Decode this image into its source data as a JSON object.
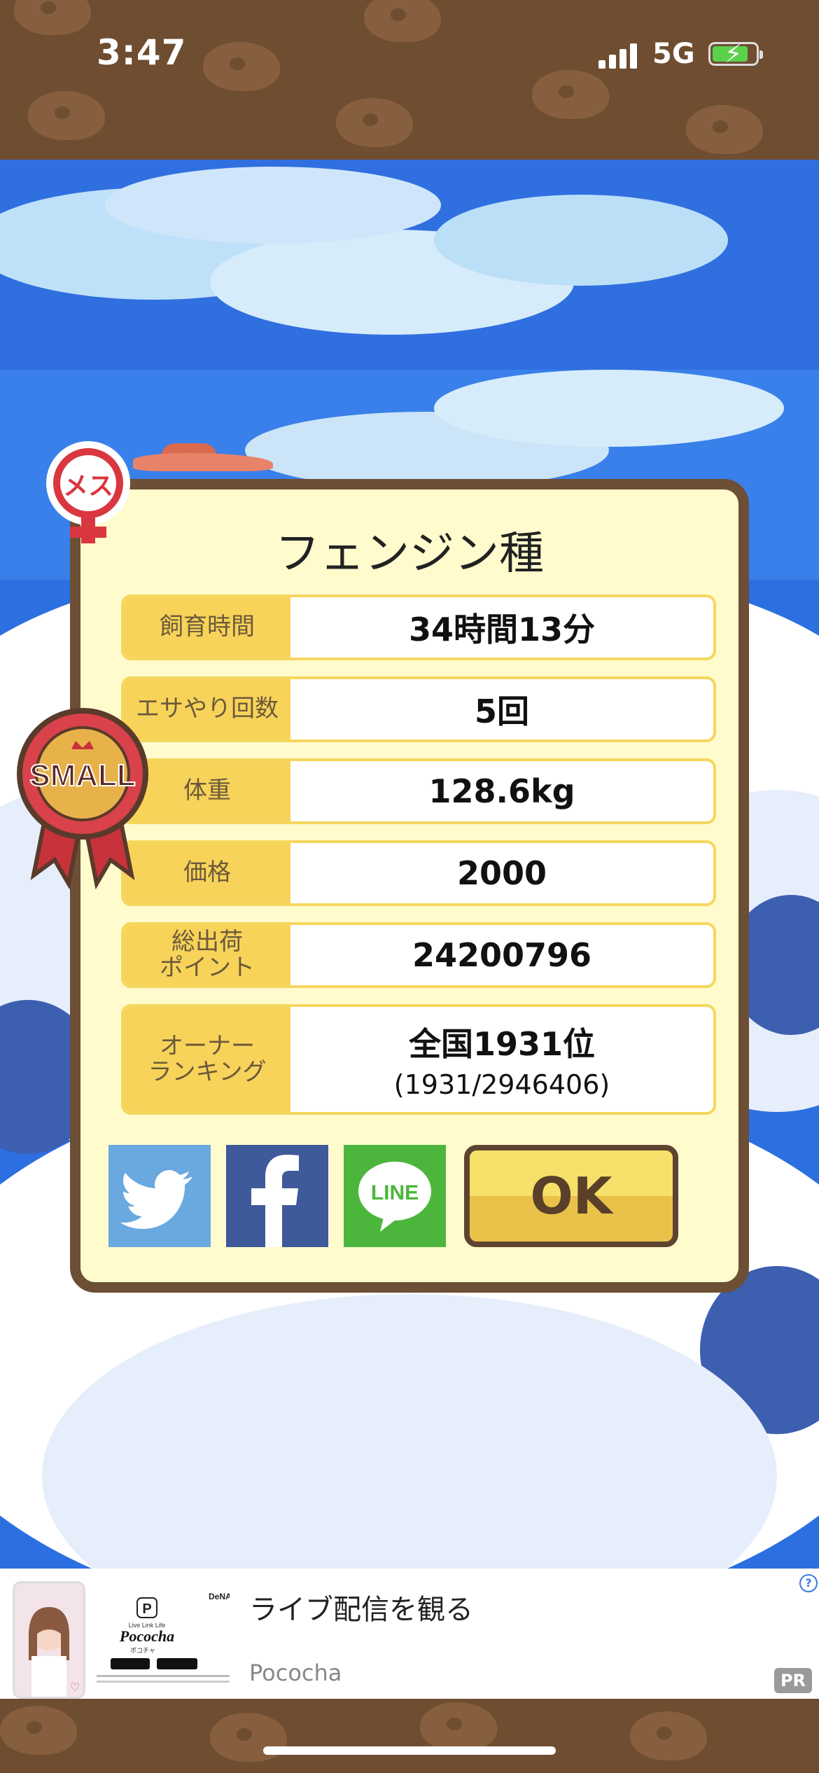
{
  "status_bar": {
    "time": "3:47",
    "network": "5G",
    "battery_icon": "battery-charging-icon",
    "signal_icon": "cellular-signal-icon"
  },
  "dialog": {
    "title": "フェンジン種",
    "rows": [
      {
        "label": "飼育時間",
        "value": "34時間13分"
      },
      {
        "label": "エサやり回数",
        "value": "5回"
      },
      {
        "label": "体重",
        "value": "128.6kg"
      },
      {
        "label": "価格",
        "value": "2000"
      },
      {
        "label": "総出荷\nポイント",
        "value": "24200796"
      },
      {
        "label": "オーナー\nランキング",
        "value": "全国1931位",
        "sub": "(1931/2946406)"
      }
    ],
    "share_buttons": {
      "twitter": "twitter-icon",
      "facebook": "facebook-icon",
      "line": "LINE"
    },
    "ok_label": "OK"
  },
  "badges": {
    "female": "メス",
    "size": "SMALL"
  },
  "ad": {
    "title": "ライブ配信を観る",
    "advertiser": "Pococha",
    "logo_tagline": "Live Link Life",
    "logo_name": "Pococha",
    "logo_sub": "ポコチャ",
    "brand_mark": "DeNA",
    "pr_label": "PR",
    "help": "?"
  },
  "colors": {
    "dialog_border": "#6c4f35",
    "dialog_bg": "#fffbcd",
    "label_bg": "#f8d35a",
    "sky": "#2c6fe0",
    "twitter": "#6aa8e0",
    "facebook": "#3e5a9a",
    "line": "#4cb63c"
  }
}
